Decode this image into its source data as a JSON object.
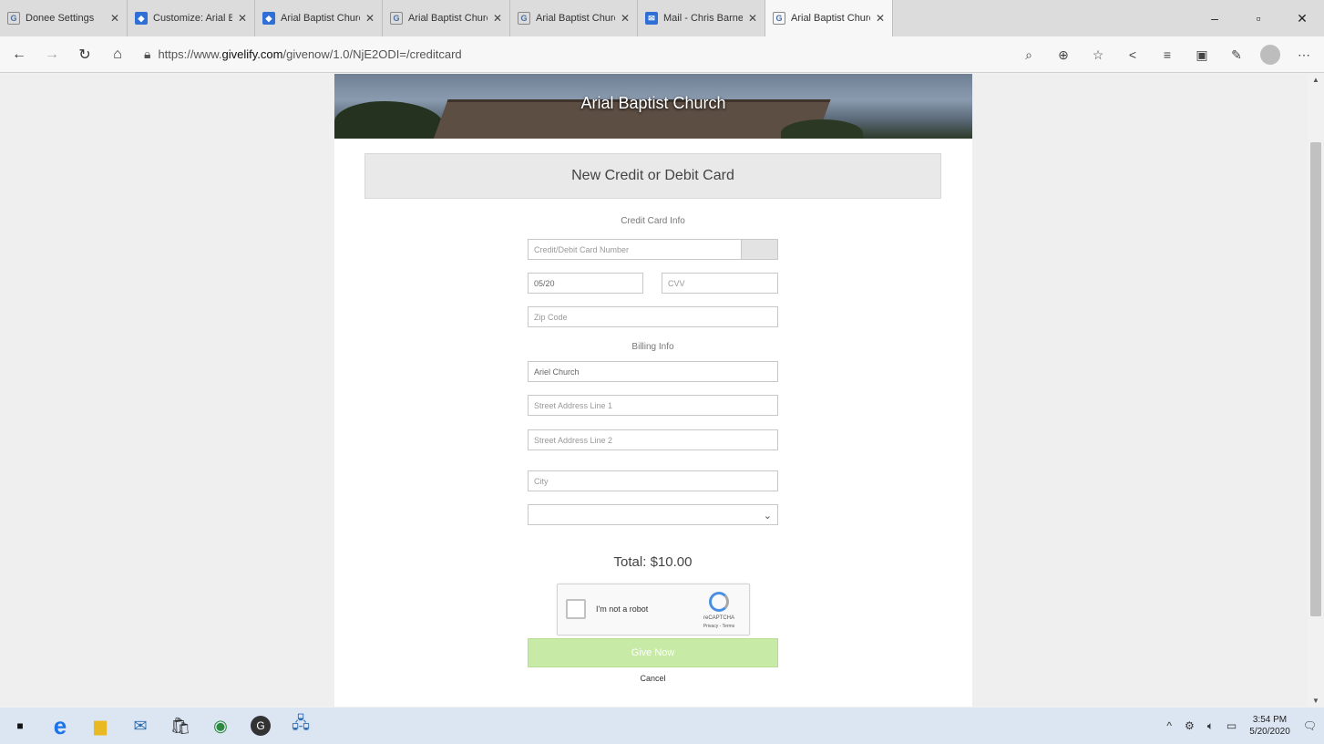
{
  "browser": {
    "tabs": [
      {
        "title": "Donee Settings",
        "icon": "G"
      },
      {
        "title": "Customize: Arial B...",
        "icon": "cube"
      },
      {
        "title": "Arial Baptist Churc",
        "icon": "cube"
      },
      {
        "title": "Arial Baptist Churc",
        "icon": "G"
      },
      {
        "title": "Arial Baptist Churc",
        "icon": "G"
      },
      {
        "title": "Mail - Chris Barne",
        "icon": "mail"
      },
      {
        "title": "Arial Baptist Churc",
        "icon": "G",
        "active": true
      }
    ],
    "url_prefix": "https://www.",
    "url_host": "givelify.com",
    "url_path": "/givenow/1.0/NjE2ODI=/creditcard"
  },
  "page": {
    "church_name": "Arial Baptist Church",
    "card_heading": "New Credit or Debit Card",
    "credit_card_info_label": "Credit Card Info",
    "card_number_placeholder": "Credit/Debit Card Number",
    "expiry_value": "05/20",
    "cvv_placeholder": "CVV",
    "zip_placeholder": "Zip Code",
    "billing_info_label": "Billing Info",
    "name_value": "Ariel Church",
    "street1_placeholder": "Street Address Line 1",
    "street2_placeholder": "Street Address Line 2",
    "city_placeholder": "City",
    "state_value": "",
    "total_label": "Total: $10.00",
    "captcha_label": "I'm not a robot",
    "captcha_brand": "reCAPTCHA",
    "captcha_terms": "Privacy - Terms",
    "submit_label": "Give Now",
    "cancel_label": "Cancel"
  },
  "taskbar": {
    "time": "3:54 PM",
    "date": "5/20/2020"
  }
}
